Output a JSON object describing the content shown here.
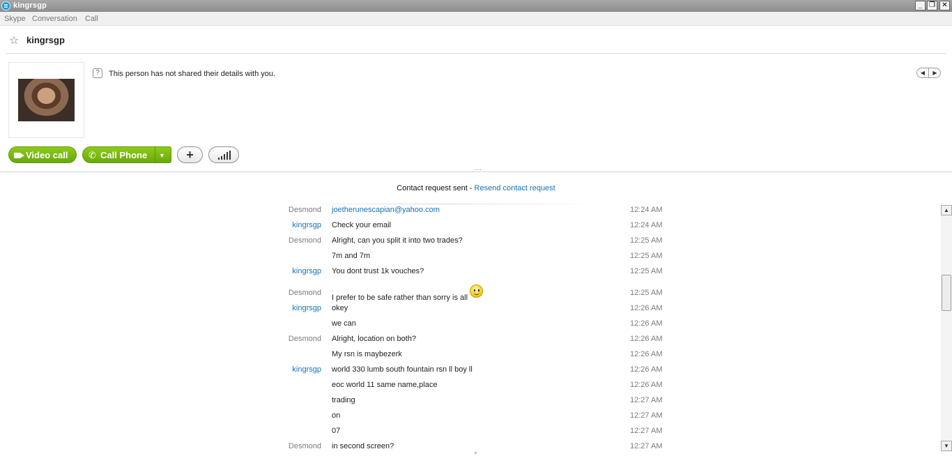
{
  "window": {
    "title": "kingrsgp",
    "controls": {
      "minimize": "_",
      "restore": "❐",
      "close": "✕"
    }
  },
  "menu": [
    "Skype",
    "Conversation",
    "Call"
  ],
  "contact": {
    "name": "kingrsgp",
    "info_text": "This person has not shared their details with you."
  },
  "actions": {
    "video_call": "Video call",
    "call_phone": "Call Phone"
  },
  "request": {
    "status": "Contact request sent - ",
    "link": "Resend contact request"
  },
  "messages": [
    {
      "sender": "Desmond",
      "text": "joetherunescapian@yahoo.com",
      "time": "12:24 AM"
    },
    {
      "sender": "kingrsgp",
      "text": "Check your email",
      "time": "12:24 AM"
    },
    {
      "sender": "Desmond",
      "text": "Alright, can you split it into two trades?",
      "time": "12:25 AM"
    },
    {
      "sender": "",
      "text": "7m and 7m",
      "time": "12:25 AM"
    },
    {
      "sender": "kingrsgp",
      "text": "You dont trust  1k vouches?",
      "time": "12:25 AM"
    },
    {
      "sender": "Desmond",
      "text": "I prefer to be safe rather than sorry is all",
      "time": "12:25 AM"
    },
    {
      "sender": "kingrsgp",
      "text": "okey",
      "time": "12:26 AM"
    },
    {
      "sender": "",
      "text": "we can",
      "time": "12:26 AM"
    },
    {
      "sender": "Desmond",
      "text": "Alright, location on both?",
      "time": "12:26 AM"
    },
    {
      "sender": "",
      "text": "My rsn is maybezerk",
      "time": "12:26 AM"
    },
    {
      "sender": "kingrsgp",
      "text": "world 330 lumb south fountain rsn ll boy ll",
      "time": "12:26 AM"
    },
    {
      "sender": "",
      "text": "eoc world 11 same name,place",
      "time": "12:26 AM"
    },
    {
      "sender": "",
      "text": "trading",
      "time": "12:27 AM"
    },
    {
      "sender": "",
      "text": "on",
      "time": "12:27 AM"
    },
    {
      "sender": "",
      "text": "07",
      "time": "12:27 AM"
    },
    {
      "sender": "Desmond",
      "text": "in second screen?",
      "time": "12:27 AM"
    }
  ]
}
